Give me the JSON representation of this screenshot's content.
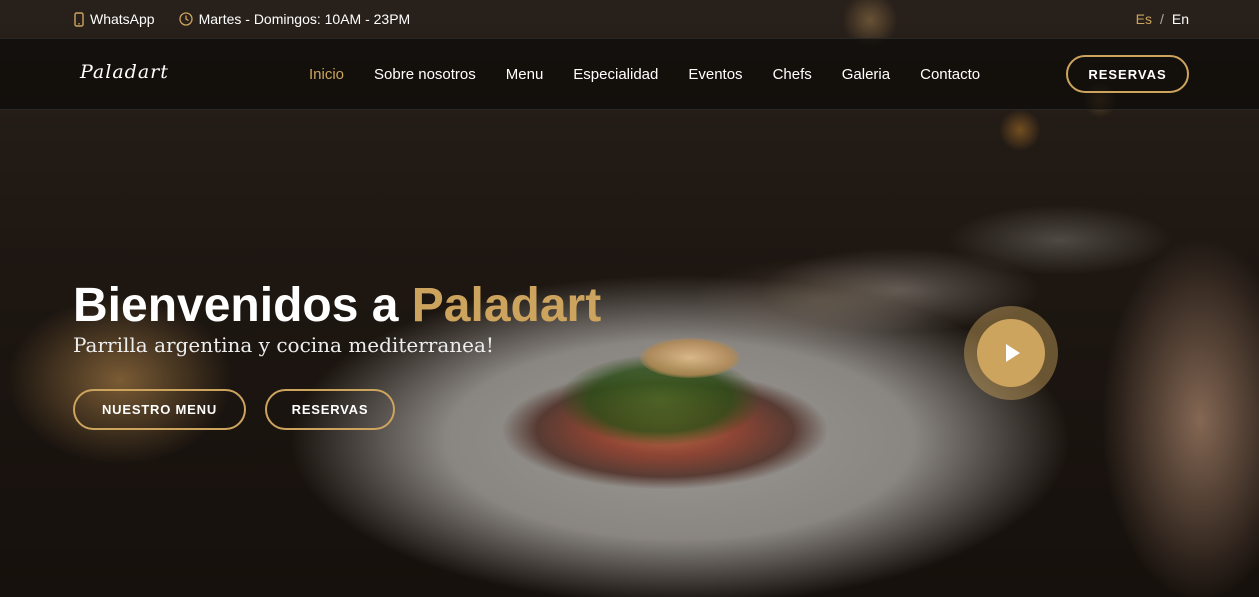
{
  "colors": {
    "accent": "#cda45e",
    "text": "#ffffff",
    "nav_bg": "#0c0b09"
  },
  "topbar": {
    "whatsapp": {
      "icon": "phone-icon",
      "label": "WhatsApp"
    },
    "hours": {
      "icon": "clock-icon",
      "label": "Martes - Domingos: 10AM - 23PM"
    },
    "languages": {
      "active": "Es",
      "separator": "/",
      "other": "En"
    }
  },
  "navbar": {
    "logo": "Paladart",
    "items": [
      {
        "label": "Inicio",
        "active": true
      },
      {
        "label": "Sobre nosotros"
      },
      {
        "label": "Menu"
      },
      {
        "label": "Especialidad"
      },
      {
        "label": "Eventos"
      },
      {
        "label": "Chefs"
      },
      {
        "label": "Galeria"
      },
      {
        "label": "Contacto"
      }
    ],
    "reserve_button": "RESERVAS"
  },
  "hero": {
    "title_prefix": "Bienvenidos a ",
    "title_accent": "Paladart",
    "subtitle": "Parrilla argentina y cocina mediterranea!",
    "buttons": {
      "menu": "NUESTRO MENU",
      "reserve": "RESERVAS"
    },
    "play_icon": "play-icon"
  }
}
